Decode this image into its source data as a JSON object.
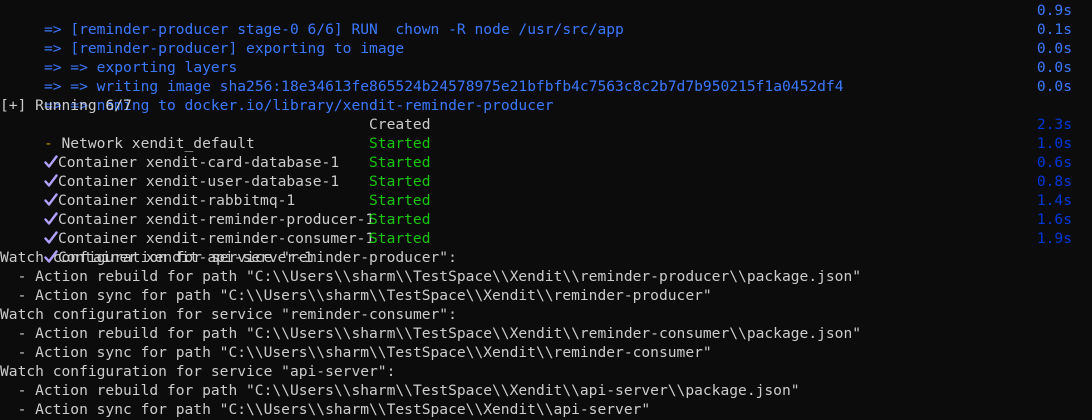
{
  "colors": {
    "background": "#0c0c0c",
    "text": "#cccccc",
    "build_blue": "#3b78ff",
    "status_green": "#16c60c",
    "network_yellow": "#c19c00",
    "check_purple": "#b4a0ff",
    "timing_blue": "#0037da"
  },
  "build_lines": [
    {
      "prefix": " => ",
      "text": "[reminder-producer stage-0 6/6] RUN  chown -R node /usr/src/app",
      "time": "0.9s"
    },
    {
      "prefix": " => ",
      "text": "[reminder-producer] exporting to image",
      "time": "0.1s"
    },
    {
      "prefix": " => => ",
      "text": "exporting layers",
      "time": "0.0s"
    },
    {
      "prefix": " => => ",
      "text": "writing image sha256:18e34613fe865524b24578975e21bfbfb4c7563c8c2b7d7b950215f1a0452df4",
      "time": "0.0s"
    },
    {
      "prefix": " => => ",
      "text": "naming to docker.io/library/xendit-reminder-producer",
      "time": "0.0s"
    }
  ],
  "running_header": "[+] Running 6/7",
  "network": {
    "icon": "dash-icon",
    "bullet": " - ",
    "label": "Network xendit_default",
    "status": "Created",
    "time": "2.3s"
  },
  "containers": [
    {
      "icon": "checkmark-icon",
      "label": "Container xendit-card-database-1",
      "status": "Started",
      "time": "1.0s"
    },
    {
      "icon": "checkmark-icon",
      "label": "Container xendit-user-database-1",
      "status": "Started",
      "time": "0.6s"
    },
    {
      "icon": "checkmark-icon",
      "label": "Container xendit-rabbitmq-1",
      "status": "Started",
      "time": "0.8s"
    },
    {
      "icon": "checkmark-icon",
      "label": "Container xendit-reminder-producer-1",
      "status": "Started",
      "time": "1.4s"
    },
    {
      "icon": "checkmark-icon",
      "label": "Container xendit-reminder-consumer-1",
      "status": "Started",
      "time": "1.6s"
    },
    {
      "icon": "checkmark-icon",
      "label": "Container xendit-api-server-1",
      "status": "Started",
      "time": "1.9s"
    }
  ],
  "watch": [
    {
      "header": "Watch configuration for service \"reminder-producer\":",
      "actions": [
        "  - Action rebuild for path \"C:\\\\Users\\\\sharm\\\\TestSpace\\\\Xendit\\\\reminder-producer\\\\package.json\"",
        "  - Action sync for path \"C:\\\\Users\\\\sharm\\\\TestSpace\\\\Xendit\\\\reminder-producer\""
      ]
    },
    {
      "header": "Watch configuration for service \"reminder-consumer\":",
      "actions": [
        "  - Action rebuild for path \"C:\\\\Users\\\\sharm\\\\TestSpace\\\\Xendit\\\\reminder-consumer\\\\package.json\"",
        "  - Action sync for path \"C:\\\\Users\\\\sharm\\\\TestSpace\\\\Xendit\\\\reminder-consumer\""
      ]
    },
    {
      "header": "Watch configuration for service \"api-server\":",
      "actions": [
        "  - Action rebuild for path \"C:\\\\Users\\\\sharm\\\\TestSpace\\\\Xendit\\\\api-server\\\\package.json\"",
        "  - Action sync for path \"C:\\\\Users\\\\sharm\\\\TestSpace\\\\Xendit\\\\api-server\""
      ]
    }
  ]
}
